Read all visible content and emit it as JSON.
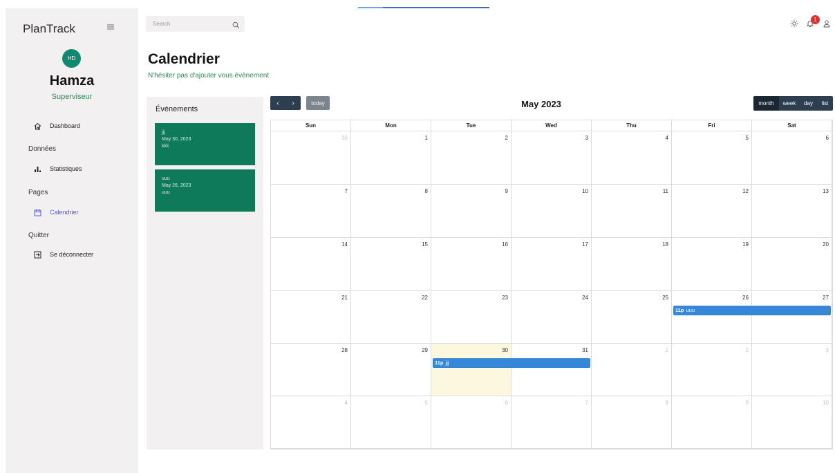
{
  "app": {
    "brand": "PlanTrack"
  },
  "user": {
    "initials": "HD",
    "name": "Hamza",
    "role": "Superviseur"
  },
  "nav": {
    "dashboard": "Dashboard",
    "section_data": "Données",
    "stats": "Statistiques",
    "section_pages": "Pages",
    "calendar": "Calendrier",
    "section_quit": "Quitter",
    "logout": "Se déconnecter"
  },
  "search": {
    "placeholder": "Search"
  },
  "header": {
    "notification_count": "1"
  },
  "page": {
    "title": "Calendrier",
    "subtitle": "N'hésiter pas d'ajouter vous évènement"
  },
  "events_panel": {
    "title": "Événements",
    "events": [
      {
        "title": "jjj",
        "date": "May 30, 2023",
        "desc": "kkk"
      },
      {
        "title": "uuu",
        "date": "May 26, 2023",
        "desc": "uuu"
      }
    ]
  },
  "calendar": {
    "title": "May 2023",
    "today_label": "today",
    "prev_icon": "chevron-left-icon",
    "next_icon": "chevron-right-icon",
    "views": [
      "month",
      "week",
      "day",
      "list"
    ],
    "active_view": "month",
    "day_names": [
      "Sun",
      "Mon",
      "Tue",
      "Wed",
      "Thu",
      "Fri",
      "Sat"
    ],
    "weeks": [
      [
        "30",
        "1",
        "2",
        "3",
        "4",
        "5",
        "6"
      ],
      [
        "7",
        "8",
        "9",
        "10",
        "11",
        "12",
        "13"
      ],
      [
        "14",
        "15",
        "16",
        "17",
        "18",
        "19",
        "20"
      ],
      [
        "21",
        "22",
        "23",
        "24",
        "25",
        "26",
        "27"
      ],
      [
        "28",
        "29",
        "30",
        "31",
        "1",
        "2",
        "3"
      ],
      [
        "4",
        "5",
        "6",
        "7",
        "8",
        "9",
        "10"
      ]
    ],
    "today_date": "May 30, 2023",
    "events": [
      {
        "time": "11p",
        "title": "uuu",
        "start": "May 26, 2023",
        "end": "May 27, 2023"
      },
      {
        "time": "11p",
        "title": "jjj",
        "start": "May 30, 2023",
        "end": "May 31, 2023"
      }
    ]
  },
  "colors": {
    "accent": "#0f8a70",
    "subtitle": "#2f8a55",
    "event_card": "#0e7a5a",
    "calendar_event": "#3787d8",
    "toolbar": "#2c3e50",
    "today_highlight": "#fcf7df",
    "badge": "#e02f2f",
    "active_nav": "#5a57e8"
  }
}
